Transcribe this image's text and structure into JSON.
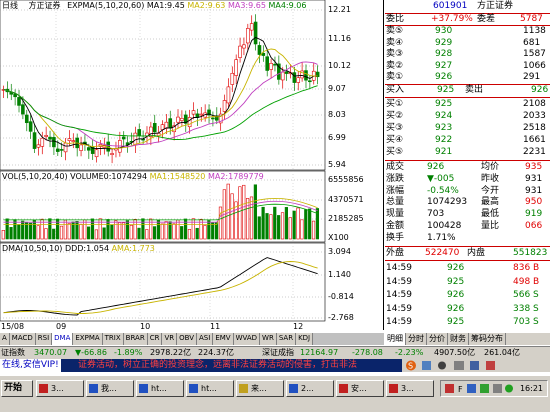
{
  "chart_header": {
    "period": "日线",
    "stock_name": "方正证券",
    "ema_label": "EXPMA(5,10,20,60)",
    "ma1": "MA1:9.45",
    "ma2": "MA2:9.63",
    "ma3": "MA3:9.65",
    "ma4": "MA4:9.06"
  },
  "price_axis": [
    "12.21",
    "11.16",
    "10.12",
    "9.07",
    "8.03",
    "6.99",
    "5.94"
  ],
  "volume_header": {
    "label": "VOL(5,10,20,40)",
    "volume": "VOLUME0:1074294",
    "ma1": "MA1:1548520",
    "ma2": "MA2:1789779"
  },
  "volume_axis": [
    "6555856",
    "4370571",
    "2185285",
    "X100"
  ],
  "dma_header": {
    "label": "DMA(10,50,10)",
    "ddd": "DDD:1.054",
    "ama": "AMA:1.773"
  },
  "dma_axis": [
    "3.094",
    "1.140",
    "-0.814",
    "-2.768"
  ],
  "x_axis": [
    "15/08",
    "09",
    "10",
    "11",
    "12"
  ],
  "indicator_tabs": [
    "MACD",
    "DMI",
    "DMA",
    "FSL",
    "TRIX",
    "BRAR",
    "CR",
    "VR",
    "OBV",
    "ASI",
    "EMV",
    "WVAD",
    "RSI",
    "WR",
    "SAR",
    "KDJ",
    "CCI",
    "ROC",
    "MTM"
  ],
  "indicator_tabs_shown": [
    "A",
    "MACD",
    "RSI",
    "DMA",
    "EXPMA",
    "TRIX",
    "BRAR",
    "CR",
    "VR",
    "OBV",
    "ASI",
    "EMV",
    "WVAD",
    "WR",
    "SAR",
    "KDJ"
  ],
  "quote": {
    "code": "601901",
    "name": "方正证券",
    "weibi_label": "委比",
    "weibi_value": "+37.79%",
    "weicha_label": "委差",
    "weicha_value": "5787",
    "asks": [
      {
        "label": "卖⑤",
        "price": "930",
        "vol": "1138"
      },
      {
        "label": "卖④",
        "price": "929",
        "vol": "681"
      },
      {
        "label": "卖③",
        "price": "928",
        "vol": "1587"
      },
      {
        "label": "卖②",
        "price": "927",
        "vol": "1066"
      },
      {
        "label": "卖①",
        "price": "926",
        "vol": "291"
      }
    ],
    "buy_in_label": "买入",
    "buy_in_value": "925",
    "sell_out_label": "卖出",
    "sell_out_value": "926",
    "bids": [
      {
        "label": "买①",
        "price": "925",
        "vol": "2108"
      },
      {
        "label": "买②",
        "price": "924",
        "vol": "2033"
      },
      {
        "label": "买③",
        "price": "923",
        "vol": "2518"
      },
      {
        "label": "买④",
        "price": "922",
        "vol": "1661"
      },
      {
        "label": "买⑤",
        "price": "921",
        "vol": "2231"
      }
    ],
    "stats": [
      {
        "l1": "成交",
        "v1": "926",
        "l2": "均价",
        "v2": "935"
      },
      {
        "l1": "涨跌",
        "v1": "▼-005",
        "l2": "昨收",
        "v2": "931"
      },
      {
        "l1": "涨幅",
        "v1": "-0.54%",
        "l2": "今开",
        "v2": "931"
      },
      {
        "l1": "总量",
        "v1": "1074293",
        "l2": "最高",
        "v2": "950"
      },
      {
        "l1": "现量",
        "v1": "703",
        "l2": "最低",
        "v2": "919"
      },
      {
        "l1": "金额",
        "v1": "100428",
        "l2": "量比",
        "v2": "066"
      },
      {
        "l1": "换手",
        "v1": "1.71%",
        "l2": "",
        "v2": ""
      }
    ],
    "outer_label": "外盘",
    "outer_value": "522470",
    "inner_label": "内盘",
    "inner_value": "551823",
    "ticks": [
      {
        "time": "14:59",
        "price": "926",
        "vol": "836 B"
      },
      {
        "time": "14:59",
        "price": "925",
        "vol": "498 B"
      },
      {
        "time": "14:59",
        "price": "926",
        "vol": "566 S"
      },
      {
        "time": "14:59",
        "price": "926",
        "vol": "338 S"
      },
      {
        "time": "14:59",
        "price": "925",
        "vol": "703 S"
      }
    ]
  },
  "panel_tabs": [
    "明细",
    "分时",
    "分价",
    "财务",
    "筹码分布"
  ],
  "status": {
    "sh_label": "证指数",
    "sh_value": "3470.07",
    "sh_change": "▼-66.86",
    "sh_pct": "-1.89%",
    "sh_amount": "2978.22亿",
    "sz_amount": "224.37亿",
    "sz_label": "深证成指",
    "sz_value": "12164.97",
    "sz_change": "-278.08",
    "sz_pct": "-2.23%",
    "sz_amount2": "4907.50亿",
    "total": "261.04亿"
  },
  "ticker": {
    "tag": "在线,安信VIP!",
    "message": "证券活动，树立正确的投资理念，远离非法证券活动的侵害，打击非法"
  },
  "taskbar": {
    "start": "开始",
    "buttons": [
      "3...",
      "我...",
      "ht...",
      "ht...",
      "来...",
      "2...",
      "安...",
      "3..."
    ],
    "clock": "16:21"
  },
  "colors": {
    "up": "#e00000",
    "down": "#008000",
    "panel_line": "#cc0000"
  }
}
